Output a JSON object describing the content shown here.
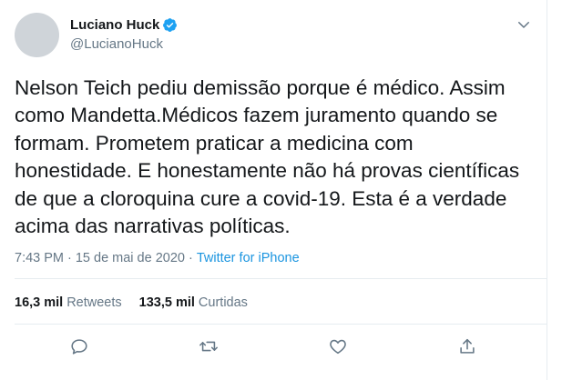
{
  "author": {
    "name": "Luciano Huck",
    "handle": "@LucianoHuck",
    "verified_color": "#1da1f2"
  },
  "tweet": {
    "text": "Nelson Teich pediu demissão porque é médico. Assim\ncomo Mandetta.Médicos fazem juramento quando se\nformam. Prometem praticar a medicina com\nhonestidade. E honestamente não há provas científicas\nde que a cloroquina cure a covid-19. Esta é a verdade\nacima das narrativas políticas.",
    "time": "7:43 PM",
    "separator": "·",
    "date": "15 de mai de 2020",
    "source": "Twitter for iPhone"
  },
  "stats": {
    "retweets_count": "16,3 mil",
    "retweets_label": "Retweets",
    "likes_count": "133,5 mil",
    "likes_label": "Curtidas"
  },
  "icons": {
    "reply": "reply-icon",
    "retweet": "retweet-icon",
    "like": "heart-icon",
    "share": "share-icon",
    "menu": "chevron-down-icon",
    "verified": "verified-badge-icon"
  },
  "colors": {
    "text": "#14171a",
    "secondary": "#657786",
    "link": "#1b95e0",
    "divider": "#e6ecf0"
  }
}
